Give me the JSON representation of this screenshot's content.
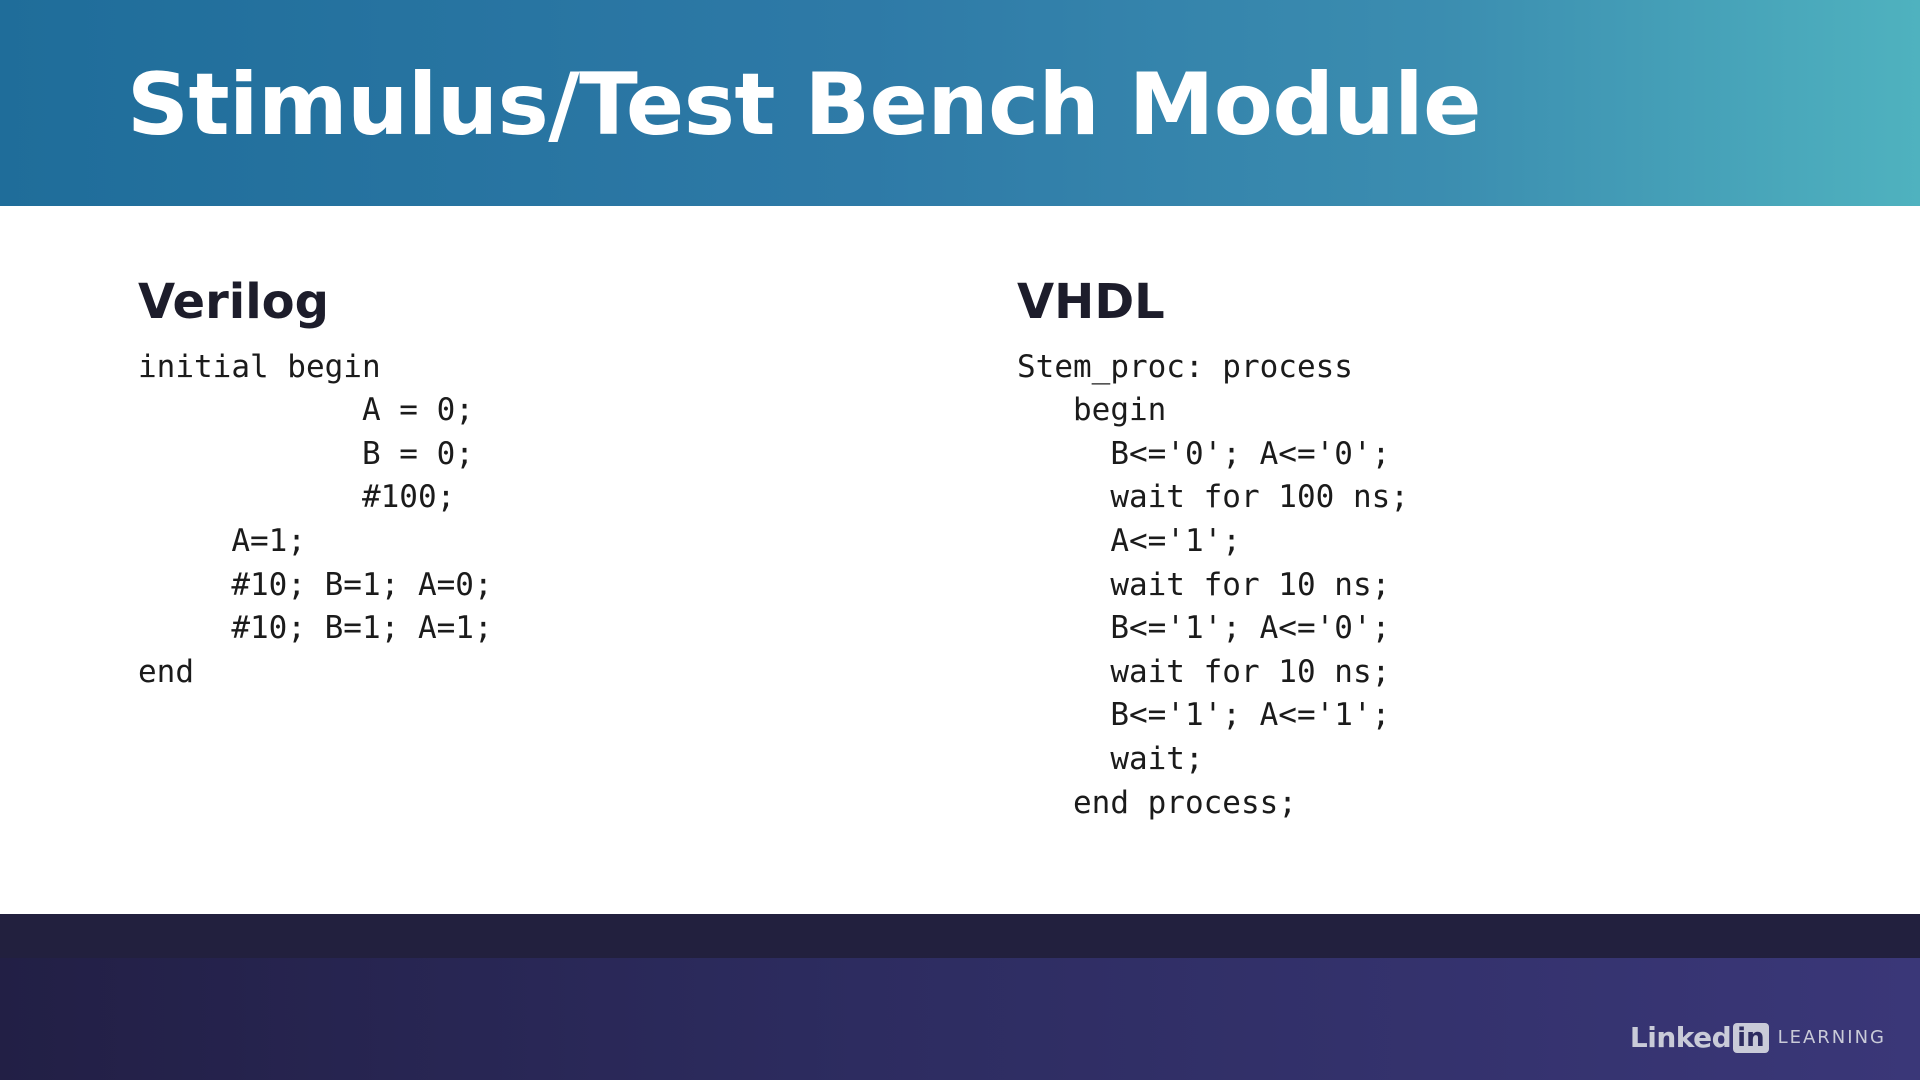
{
  "slide": {
    "title": "Stimulus/Test Bench Module"
  },
  "verilog": {
    "heading": "Verilog",
    "lines": [
      "initial begin",
      "            A = 0;",
      "            B = 0;",
      "            #100;",
      "     A=1;",
      "     #10; B=1; A=0;",
      "     #10; B=1; A=1;",
      "end"
    ]
  },
  "vhdl": {
    "heading": "VHDL",
    "lines": [
      "Stem_proc: process",
      "   begin",
      "     B<='0'; A<='0';",
      "     wait for 100 ns;",
      "     A<='1';",
      "     wait for 10 ns;",
      "     B<='1'; A<='0';",
      "     wait for 10 ns;",
      "     B<='1'; A<='1';",
      "     wait;",
      "   end process;"
    ]
  },
  "branding": {
    "linked": "Linked",
    "in": "in",
    "learning": "LEARNING"
  }
}
